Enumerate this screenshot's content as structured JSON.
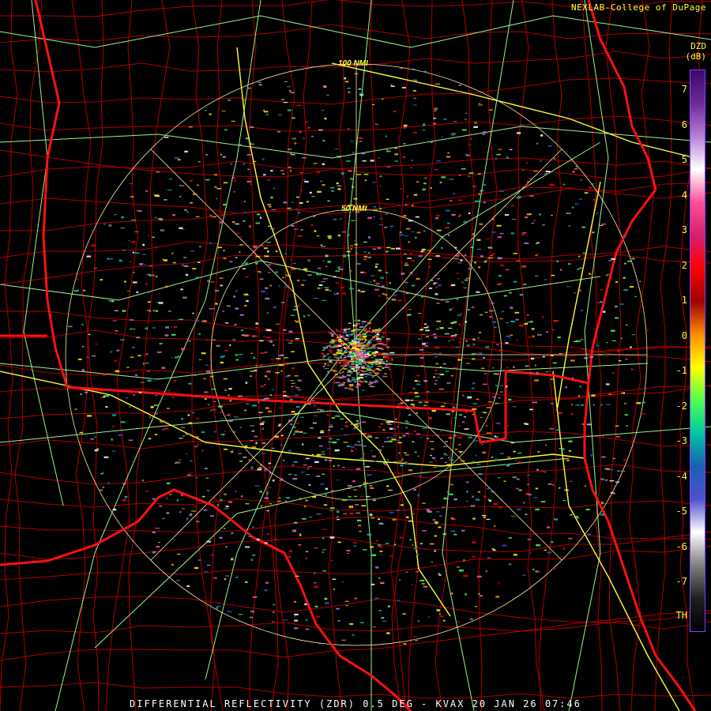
{
  "header": {
    "credit": "NEXLAB-College of DuPage"
  },
  "footer": {
    "caption": "DIFFERENTIAL REFLECTIVITY (ZDR) 0.5 DEG - KVAX 20 JAN 26 07:46"
  },
  "legend": {
    "product": "DZD",
    "unit": "(dB)",
    "ticks": [
      "7",
      "6",
      "5",
      "4",
      "3",
      "2",
      "1",
      "0",
      "-1",
      "-2",
      "-3",
      "-4",
      "-5",
      "-6",
      "-7",
      "TH"
    ],
    "colors": [
      "#3b0a6a",
      "#6d2a9a",
      "#b87fd8",
      "#ffffff",
      "#ff4f9a",
      "#d42070",
      "#ff0000",
      "#9c0000",
      "#ff8c00",
      "#ffff00",
      "#50ff50",
      "#00c8a0",
      "#1a5fb4",
      "#5050d0",
      "#ffffff",
      "#808080",
      "#202020",
      "#000000"
    ]
  },
  "range_rings": [
    "100 NMI",
    "50 NMI"
  ],
  "colors": {
    "state_border": "#ff1010",
    "county_border": "#c00000",
    "highway": "#9cf28c",
    "interstate": "#ffff33",
    "ring": "#ffe8a0"
  }
}
